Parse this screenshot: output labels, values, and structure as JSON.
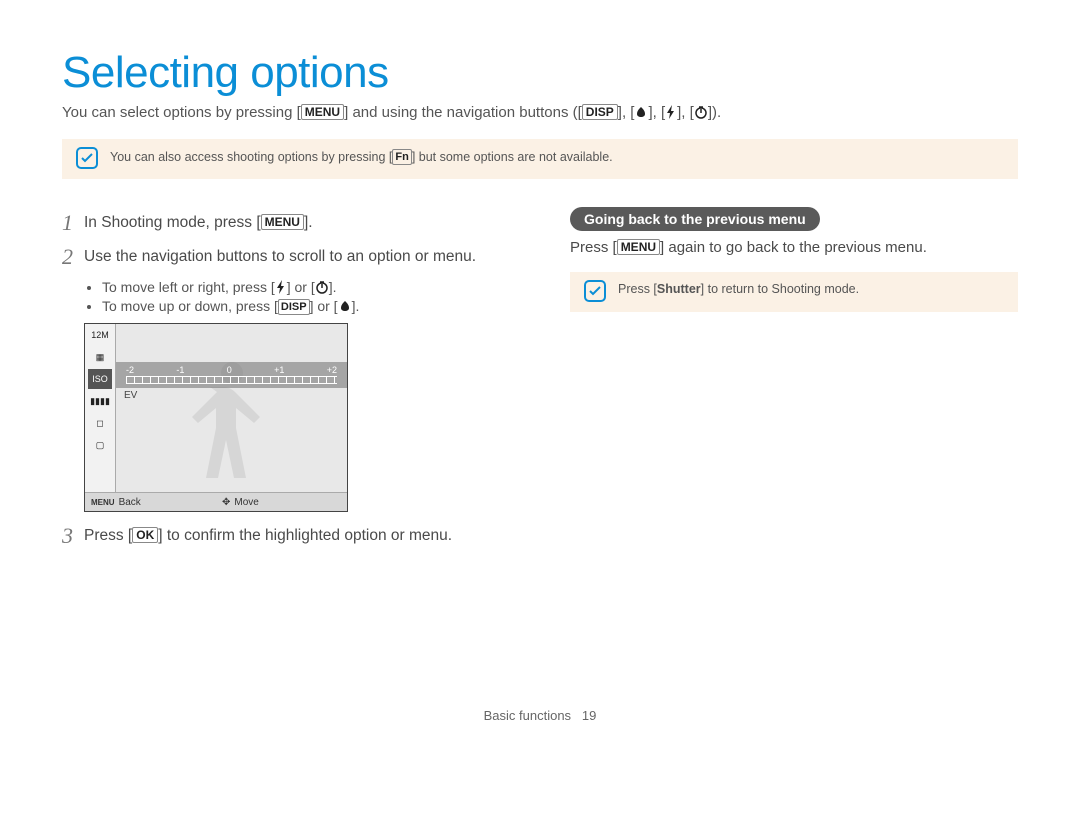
{
  "title": "Selecting options",
  "intro": {
    "pre": "You can select options by pressing [",
    "menu": "MENU",
    "mid": "] and using the navigation buttons ([",
    "disp": "DISP",
    "post": "]).",
    "comma": "], [",
    "sep": ", ["
  },
  "note1": {
    "pre": "You can also access shooting options by pressing [",
    "fn": "Fn",
    "post": "] but some options are not available."
  },
  "steps": {
    "s1_num": "1",
    "s1_pre": "In Shooting mode, press [",
    "s1_key": "MENU",
    "s1_post": "].",
    "s2_num": "2",
    "s2_text": "Use the navigation buttons to scroll to an option or menu.",
    "s2_b1_pre": "To move left or right, press [",
    "s2_b1_mid": "] or [",
    "s2_b1_post": "].",
    "s2_b2_pre": "To move up or down, press [",
    "s2_b2_disp": "DISP",
    "s2_b2_mid": "] or [",
    "s2_b2_post": "].",
    "s3_num": "3",
    "s3_pre": "Press [",
    "s3_key": "OK",
    "s3_post": "] to confirm the highlighted option or menu."
  },
  "screenshot": {
    "side": [
      "12M",
      "▦",
      "ISO",
      "▮▮▮▮",
      "◻",
      "▢"
    ],
    "ev_labels": [
      "-2",
      "-1",
      "0",
      "+1",
      "+2"
    ],
    "ev": "EV",
    "footer_back_key": "MENU",
    "footer_back": "Back",
    "footer_move": "Move"
  },
  "right": {
    "heading": "Going back to the previous menu",
    "pre": "Press [",
    "key": "MENU",
    "post": "] again to go back to the previous menu."
  },
  "note2": {
    "pre": "Press [",
    "shutter": "Shutter",
    "post": "] to return to Shooting mode."
  },
  "footer": {
    "section": "Basic functions",
    "page": "19"
  }
}
